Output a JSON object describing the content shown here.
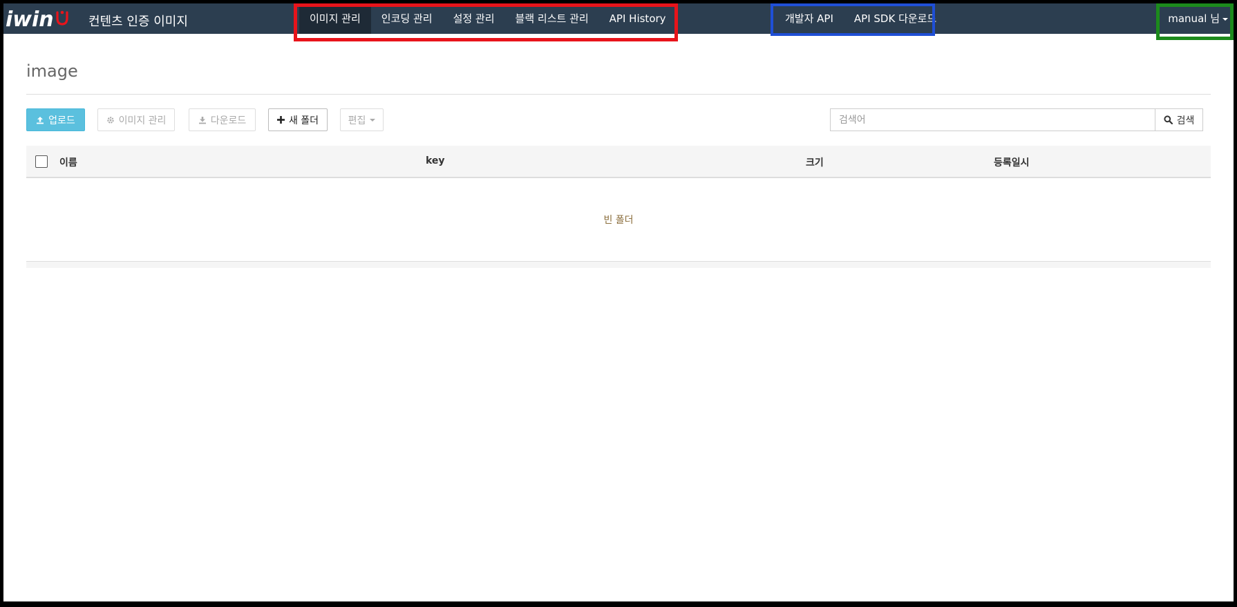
{
  "brand": {
    "logo_text": "iwin",
    "title": "컨텐츠 인증 이미지",
    "logo_accent_color": "#e8141b"
  },
  "nav": {
    "main_items": [
      {
        "label": "이미지 관리",
        "active": true
      },
      {
        "label": "인코딩 관리",
        "active": false
      },
      {
        "label": "설정 관리",
        "active": false
      },
      {
        "label": "블랙 리스트 관리",
        "active": false
      },
      {
        "label": "API History",
        "active": false
      }
    ],
    "dev_items": [
      {
        "label": "개발자 API"
      },
      {
        "label": "API SDK 다운로드"
      }
    ],
    "user": {
      "label": "manual 님"
    }
  },
  "page": {
    "title": "image"
  },
  "toolbar": {
    "upload_label": "업로드",
    "manage_label": "이미지 관리",
    "download_label": "다운로드",
    "new_folder_label": "새 폴더",
    "edit_label": "편집"
  },
  "search": {
    "placeholder": "검색어",
    "value": "",
    "button_label": "검색"
  },
  "table": {
    "columns": [
      "이름",
      "key",
      "크기",
      "등록일시"
    ],
    "rows": [],
    "empty_text": "빈 폴더"
  },
  "colors": {
    "navbar_bg": "#2c3e50",
    "nav_active_bg": "#1e2a36",
    "primary_button": "#5bc0de",
    "empty_text": "#8a6d3b",
    "highlight_red": "#e8141b",
    "highlight_blue": "#1f4fd6",
    "highlight_green": "#1c8a1c"
  }
}
